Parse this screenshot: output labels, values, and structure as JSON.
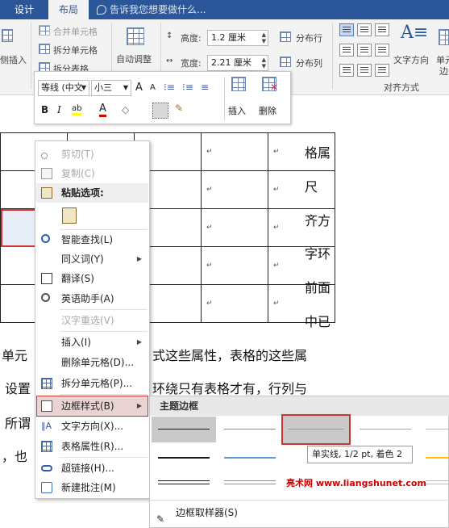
{
  "ribbon_tabs": {
    "design": "设计",
    "layout": "布局",
    "tell_me": "告诉我您想要做什么..."
  },
  "ribbon": {
    "merge_cells": "合并单元格",
    "split_cells": "拆分单元格",
    "split_table": "拆分表格",
    "insert_side": "侧插入",
    "autofit": "自动调整",
    "height_label": "高度:",
    "height_value": "1.2 厘米",
    "width_label": "宽度:",
    "width_value": "2.21 厘米",
    "distribute_rows": "分布行",
    "distribute_cols": "分布列",
    "text_direction": "文字方向",
    "cell_margins": "单元",
    "cell_margins_2": "边",
    "alignment_group": "对齐方式"
  },
  "mini_toolbar": {
    "font": "等线 (中文",
    "size": "小三",
    "grow_font": "A",
    "shrink_font": "A",
    "bold": "B",
    "italic": "I",
    "highlight": "ab",
    "font_color": "A",
    "insert": "插入",
    "delete": "删除"
  },
  "context_menu": {
    "cut": "剪切(T)",
    "copy": "复制(C)",
    "paste_options": "粘贴选项:",
    "smart_lookup": "智能查找(L)",
    "synonyms": "同义词(Y)",
    "translate": "翻译(S)",
    "english_assistant": "英语助手(A)",
    "reconvert": "汉字重选(V)",
    "insert": "插入(I)",
    "delete_cells": "删除单元格(D)...",
    "split_cells": "拆分单元格(P)...",
    "border_styles": "边框样式(B)",
    "text_direction": "文字方向(X)...",
    "table_properties": "表格属性(R)...",
    "hyperlink": "超链接(H)...",
    "new_comment": "新建批注(M)"
  },
  "submenu": {
    "title": "主题边框",
    "tooltip": "单实线, 1/2 pt, 着色 2",
    "border_painter": "边框取样器(S)",
    "colors": {
      "black": "#1a1a1a",
      "blue": "#5b9bd5",
      "orange": "#ed7d31",
      "gray": "#a5a5a5",
      "gold": "#ffc000"
    }
  },
  "watermark": "亮术网 www.liangshunet.com",
  "document": {
    "right_column": [
      "格属",
      "尺",
      "齐方",
      "字环",
      "前面",
      "中已"
    ],
    "line1_left": "单元",
    "line1_right": "式这些属性，表格的这些属",
    "line2_left": "设置",
    "line2_right": "环绕只有表格才有，行列与",
    "line3_left": "所谓",
    "line4_left": "，也",
    "para_mark": "↵"
  }
}
